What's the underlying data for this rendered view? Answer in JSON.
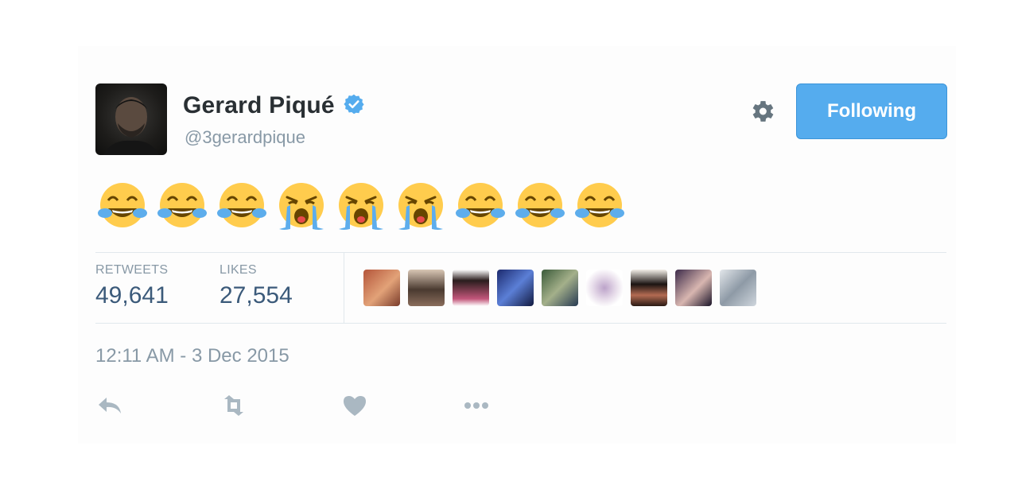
{
  "tweet": {
    "author_name": "Gerard Piqué",
    "author_handle": "@3gerardpique",
    "follow_button_label": "Following",
    "emojis": [
      "laugh-tears",
      "laugh-tears",
      "laugh-tears",
      "sob",
      "sob",
      "sob",
      "laugh-tears",
      "laugh-tears",
      "laugh-tears"
    ],
    "stats": {
      "retweets_label": "RETWEETS",
      "retweets_value": "49,641",
      "likes_label": "LIKES",
      "likes_value": "27,554"
    },
    "timestamp": "12:11 AM - 3 Dec 2015",
    "actions": [
      "reply-icon",
      "retweet-icon",
      "like-icon",
      "more-icon"
    ]
  },
  "colors": {
    "accent": "#55acee",
    "verified": "#55acee",
    "muted_text": "#8899a6",
    "icon_gray": "#aab8c2"
  }
}
